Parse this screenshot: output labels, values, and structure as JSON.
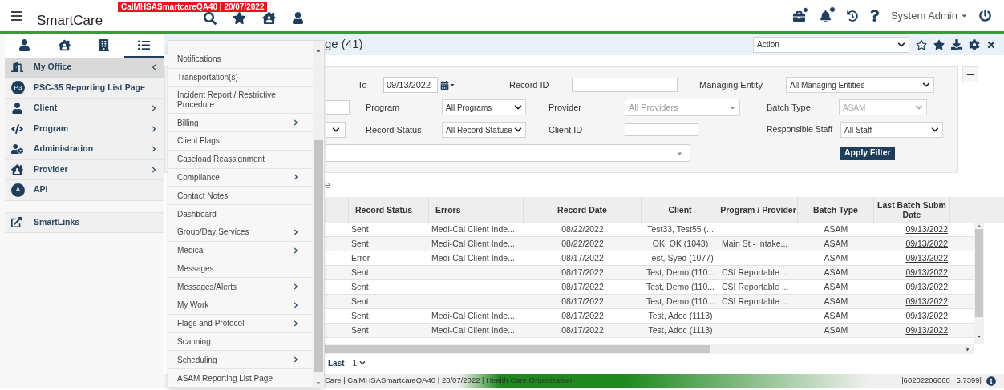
{
  "header": {
    "env_badge": "CalMHSASmartcareQA40 | 20/07/2022",
    "logo": "SmartCare",
    "user_menu": "System Admin"
  },
  "sidebar": {
    "tabs": [
      {
        "selected": false
      },
      {
        "selected": false
      },
      {
        "selected": false
      },
      {
        "selected": true
      }
    ],
    "items": [
      {
        "label": "My Office",
        "expanded": true,
        "selected": true,
        "arrow": true
      },
      {
        "label": "PSC-35 Reporting List Page",
        "badge": "P3",
        "selected": false,
        "arrow": false
      },
      {
        "label": "Client",
        "expanded": false,
        "selected": false,
        "arrow": true
      },
      {
        "label": "Program",
        "expanded": false,
        "selected": false,
        "arrow": true
      },
      {
        "label": "Administration",
        "expanded": false,
        "selected": false,
        "arrow": true
      },
      {
        "label": "Provider",
        "expanded": false,
        "selected": false,
        "arrow": true
      },
      {
        "label": "API",
        "badge": "A",
        "selected": false,
        "arrow": false
      }
    ],
    "smartlinks": "SmartLinks"
  },
  "menu": {
    "items": [
      {
        "label": "Notifications",
        "submenu": false
      },
      {
        "label": "Transportation(s)",
        "submenu": false
      },
      {
        "label": "Incident Report / Restrictive Procedure",
        "submenu": false
      },
      {
        "label": "Billing",
        "submenu": true
      },
      {
        "label": "Client Flags",
        "submenu": false
      },
      {
        "label": "Caseload Reassignment",
        "submenu": false
      },
      {
        "label": "Compliance",
        "submenu": true
      },
      {
        "label": "Contact Notes",
        "submenu": false
      },
      {
        "label": "Dashboard",
        "submenu": false
      },
      {
        "label": "Group/Day Services",
        "submenu": true
      },
      {
        "label": "Medical",
        "submenu": true
      },
      {
        "label": "Messages",
        "submenu": false
      },
      {
        "label": "Messages/Alerts",
        "submenu": true
      },
      {
        "label": "My Work",
        "submenu": true
      },
      {
        "label": "Flags and Protocol",
        "submenu": true
      },
      {
        "label": "Scanning",
        "submenu": false
      },
      {
        "label": "Scheduling",
        "submenu": true
      },
      {
        "label": "ASAM Reporting List Page",
        "submenu": false
      }
    ]
  },
  "page": {
    "title": "ge (41)",
    "action_select": "Action"
  },
  "filters": {
    "to_label": "To",
    "to_date": "09/13/2022",
    "record_id_label": "Record ID",
    "managing_entity_label": "Managing Entity",
    "managing_entity": "All Managing Entities",
    "program_label": "Program",
    "program": "All Programs",
    "provider_label": "Provider",
    "provider_placeholder": "All Providers",
    "batch_type_label": "Batch Type",
    "batch_type": "ASAM",
    "record_status_label": "Record Status",
    "record_status": "All Record Statuse",
    "client_id_label": "Client ID",
    "responsible_staff_label": "Responsible Staff",
    "responsible_staff": "All Staff",
    "apply_button": "Apply Filter"
  },
  "section_label": "e",
  "table": {
    "columns": [
      "Record Status",
      "Errors",
      "Record Date",
      "Client",
      "Program / Provider",
      "Batch Type",
      "Last Batch Subm Date"
    ],
    "rows": [
      [
        "Sent",
        "Medi-Cal Client Inde...",
        "08/22/2022",
        "Test33, Test55 (...",
        "",
        "ASAM",
        "09/13/2022"
      ],
      [
        "Sent",
        "Medi-Cal Client Inde...",
        "08/22/2022",
        "OK, OK (1043)",
        "Main St - Intake...",
        "ASAM",
        "09/13/2022"
      ],
      [
        "Error",
        "Medi-Cal Client Inde...",
        "08/17/2022",
        "Test, Syed (1077)",
        "",
        "ASAM",
        "09/13/2022"
      ],
      [
        "Sent",
        "",
        "08/17/2022",
        "Test, Demo (110...",
        "CSI Reportable ...",
        "ASAM",
        "09/13/2022"
      ],
      [
        "Sent",
        "",
        "08/17/2022",
        "Test, Demo (110...",
        "CSI Reportable ...",
        "ASAM",
        "09/13/2022"
      ],
      [
        "Sent",
        "",
        "08/17/2022",
        "Test, Demo (110...",
        "CSI Reportable ...",
        "ASAM",
        "09/13/2022"
      ],
      [
        "Sent",
        "Medi-Cal Client Inde...",
        "08/17/2022",
        "Test, Adoc (1113)",
        "",
        "ASAM",
        "09/13/2022"
      ],
      [
        "Sent",
        "Medi-Cal Client Inde...",
        "08/17/2022",
        "Test, Adoc (1113)",
        "",
        "ASAM",
        "09/13/2022"
      ]
    ]
  },
  "pagination": {
    "last": "Last",
    "page": "1"
  },
  "status_bar": {
    "left": "Care | CalMHSASmartcareQA40 | 20/07/2022 | Health Care Organization",
    "right": "|60202206060 | 5.7399|"
  }
}
